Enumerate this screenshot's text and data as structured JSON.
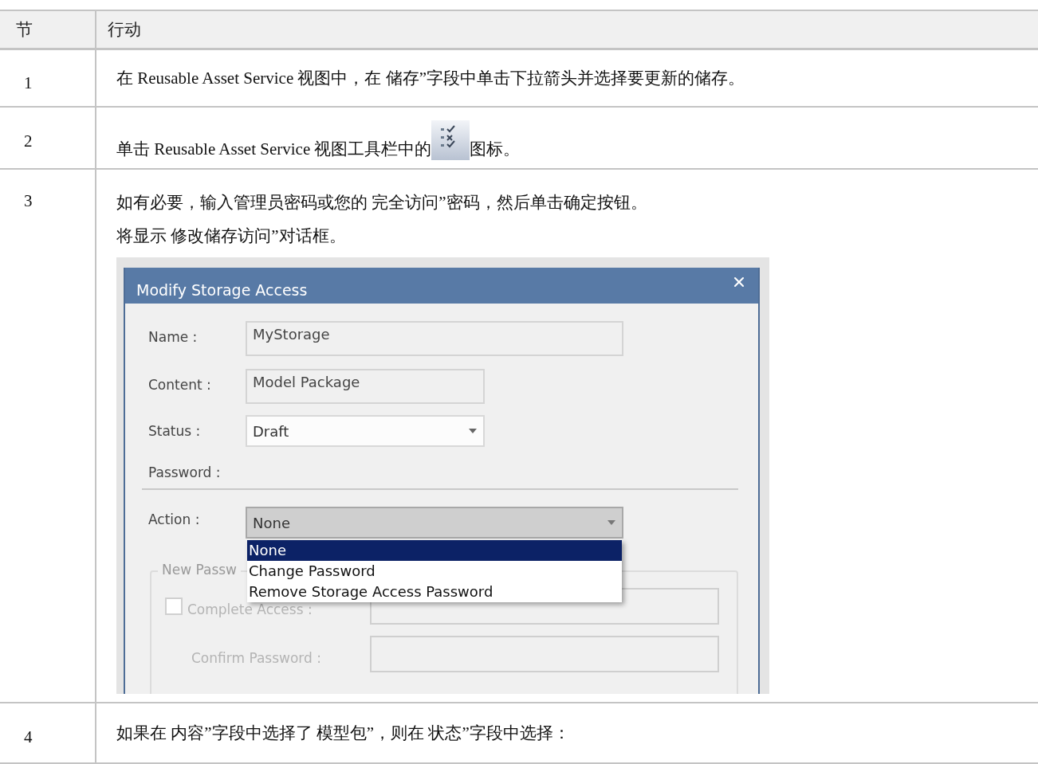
{
  "table": {
    "columns": [
      {
        "label": "节"
      },
      {
        "label": "行动"
      }
    ],
    "rows": [
      {
        "step": "1",
        "content": [
          {
            "kind": "text",
            "text": "在 Reusable Asset Service 视图中，在 储存”字段中单击下拉箭头并选择要更新的储存。"
          }
        ]
      },
      {
        "step": "2",
        "content": [
          {
            "kind": "inline",
            "parts": [
              {
                "kind": "text",
                "text": "单击 Reusable Asset Service 视图工具栏中的"
              },
              {
                "kind": "icon"
              },
              {
                "kind": "text",
                "text": "图标。"
              }
            ]
          }
        ]
      },
      {
        "step": "3",
        "content": [
          {
            "kind": "text",
            "text": "如有必要，输入管理员密码或您的 完全访问”密码，然后单击确定按钮。"
          },
          {
            "kind": "text",
            "text": "将显示 修改储存访问”对话框。"
          },
          {
            "kind": "dialog",
            "dialog": {
              "title": "Modify Storage Access",
              "fields": [
                {
                  "kind": "text",
                  "label": "Name :",
                  "value": "MyStorage"
                },
                {
                  "kind": "text",
                  "label": "Content :",
                  "value": "Model Package"
                },
                {
                  "kind": "select",
                  "label": "Status :",
                  "value": "Draft"
                }
              ],
              "section": "Password :",
              "action": {
                "label": "Action :",
                "value": "None",
                "expanded": true,
                "options": [
                  {
                    "label": "None",
                    "selected": true
                  },
                  {
                    "label": "Change Password",
                    "selected": false
                  },
                  {
                    "label": "Remove Storage Access Password",
                    "selected": false
                  }
                ]
              },
              "group": {
                "legend": "New Passw",
                "disabled": true,
                "rows": [
                  {
                    "kind": "checkbox",
                    "label": "Complete Access :",
                    "checked": false
                  },
                  {
                    "kind": "field",
                    "label": "Confirm Password :"
                  }
                ]
              }
            }
          }
        ]
      },
      {
        "step": "4",
        "content": [
          {
            "kind": "text",
            "text": "如果在 内容”字段中选择了 模型包”，则在 状态”字段中选择："
          }
        ]
      }
    ]
  }
}
